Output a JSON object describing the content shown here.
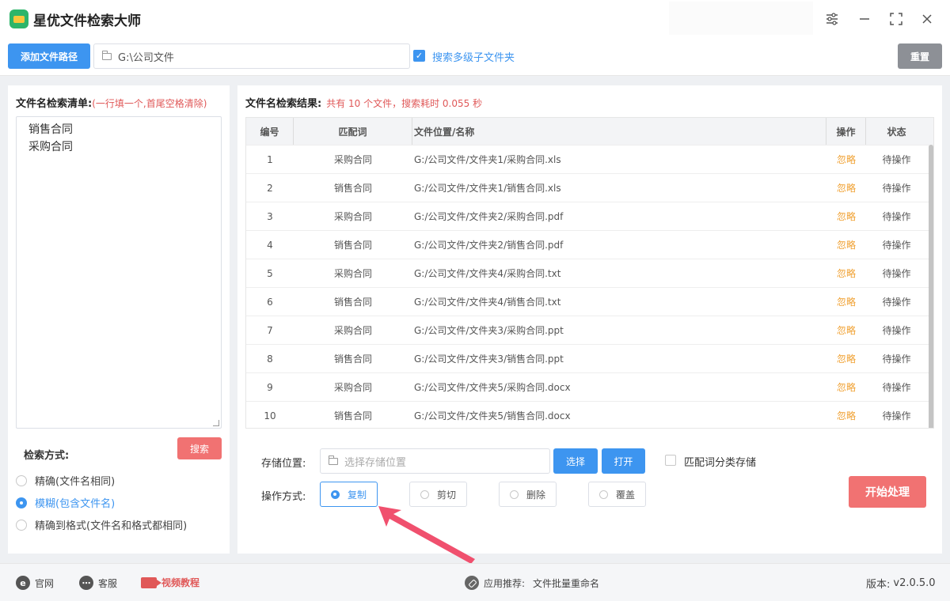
{
  "app": {
    "title": "星优文件检索大师"
  },
  "window_controls": {
    "settings": "⚙",
    "minimize": "—",
    "maximize": "⛶",
    "close": "✕"
  },
  "toolbar": {
    "add_path_label": "添加文件路径",
    "path_value": "G:\\公司文件",
    "multi_level_checked": true,
    "multi_level_label": "搜索多级子文件夹",
    "reset_label": "重置"
  },
  "left_panel": {
    "title": "文件名检索清单:",
    "hint": "(一行填一个,首尾空格清除)",
    "keywords": [
      "销售合同",
      "采购合同"
    ],
    "search_label": "搜索",
    "mode_label": "检索方式:",
    "modes": [
      {
        "label": "精确(文件名相同)",
        "selected": false
      },
      {
        "label": "模糊(包含文件名)",
        "selected": true
      },
      {
        "label": "精确到格式(文件名和格式都相同)",
        "selected": false
      }
    ]
  },
  "results": {
    "title": "文件名检索结果:",
    "summary": "共有 10 个文件，搜索耗时 0.055 秒",
    "columns": [
      "编号",
      "匹配词",
      "文件位置/名称",
      "操作",
      "状态"
    ],
    "rows": [
      {
        "no": "1",
        "keyword": "采购合同",
        "path": "G:/公司文件/文件夹1/采购合同.xls",
        "op": "忽略",
        "status": "待操作"
      },
      {
        "no": "2",
        "keyword": "销售合同",
        "path": "G:/公司文件/文件夹1/销售合同.xls",
        "op": "忽略",
        "status": "待操作"
      },
      {
        "no": "3",
        "keyword": "采购合同",
        "path": "G:/公司文件/文件夹2/采购合同.pdf",
        "op": "忽略",
        "status": "待操作"
      },
      {
        "no": "4",
        "keyword": "销售合同",
        "path": "G:/公司文件/文件夹2/销售合同.pdf",
        "op": "忽略",
        "status": "待操作"
      },
      {
        "no": "5",
        "keyword": "采购合同",
        "path": "G:/公司文件/文件夹4/采购合同.txt",
        "op": "忽略",
        "status": "待操作"
      },
      {
        "no": "6",
        "keyword": "销售合同",
        "path": "G:/公司文件/文件夹4/销售合同.txt",
        "op": "忽略",
        "status": "待操作"
      },
      {
        "no": "7",
        "keyword": "采购合同",
        "path": "G:/公司文件/文件夹3/采购合同.ppt",
        "op": "忽略",
        "status": "待操作"
      },
      {
        "no": "8",
        "keyword": "销售合同",
        "path": "G:/公司文件/文件夹3/销售合同.ppt",
        "op": "忽略",
        "status": "待操作"
      },
      {
        "no": "9",
        "keyword": "采购合同",
        "path": "G:/公司文件/文件夹5/采购合同.docx",
        "op": "忽略",
        "status": "待操作"
      },
      {
        "no": "10",
        "keyword": "销售合同",
        "path": "G:/公司文件/文件夹5/销售合同.docx",
        "op": "忽略",
        "status": "待操作"
      }
    ]
  },
  "storage": {
    "label": "存储位置:",
    "placeholder": "选择存储位置",
    "choose_label": "选择",
    "open_label": "打开",
    "classify_label": "匹配词分类存储",
    "classify_checked": false
  },
  "operation": {
    "label": "操作方式:",
    "options": [
      {
        "label": "复制",
        "selected": true
      },
      {
        "label": "剪切",
        "selected": false
      },
      {
        "label": "删除",
        "selected": false
      },
      {
        "label": "覆盖",
        "selected": false
      }
    ],
    "start_label": "开始处理"
  },
  "footer": {
    "website": "官网",
    "service": "客服",
    "video": "视频教程",
    "recommend_label": "应用推荐:",
    "recommend_app": "文件批量重命名",
    "version_label": "版本:",
    "version": "v2.0.5.0"
  },
  "colors": {
    "accent": "#3d95f0",
    "danger": "#f17272",
    "warn": "#f0a030",
    "grey_button": "#8d9096",
    "arrow": "#f0506e"
  }
}
